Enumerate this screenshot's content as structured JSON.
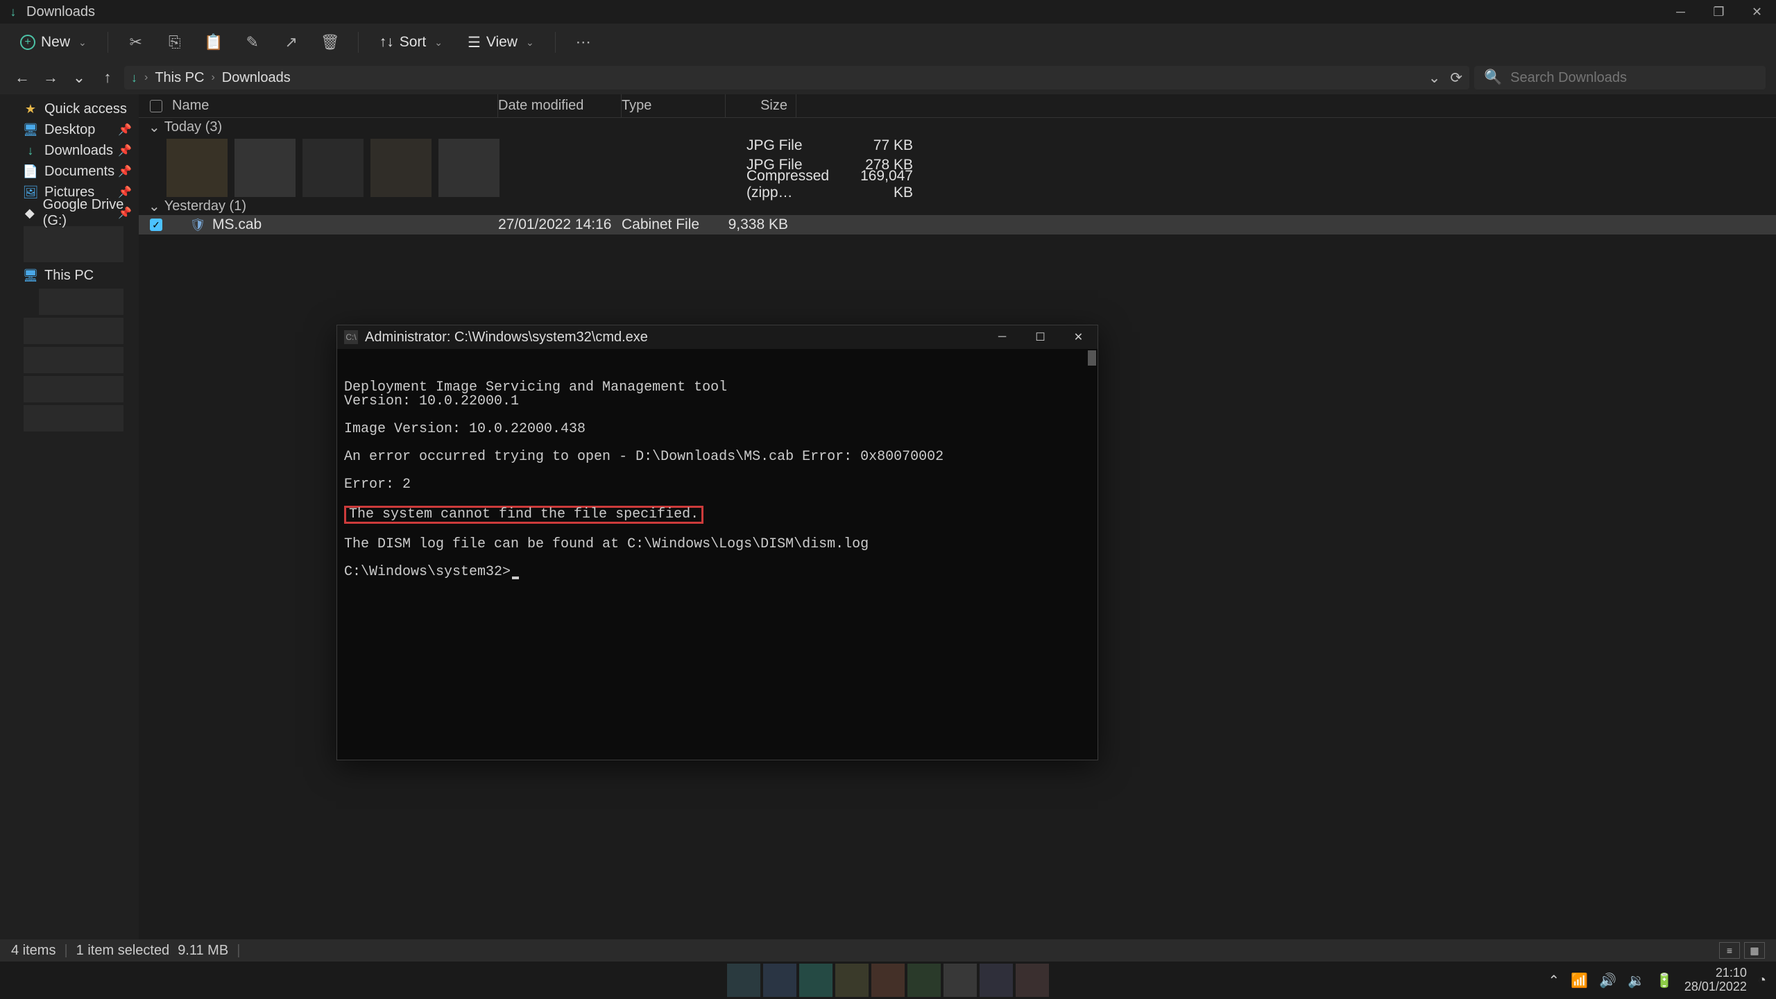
{
  "titlebar": {
    "title": "Downloads"
  },
  "toolbar": {
    "new": "New",
    "sort": "Sort",
    "view": "View"
  },
  "breadcrumb": {
    "root": "This PC",
    "current": "Downloads"
  },
  "search": {
    "placeholder": "Search Downloads"
  },
  "sidebar": {
    "quick_access": "Quick access",
    "desktop": "Desktop",
    "downloads": "Downloads",
    "documents": "Documents",
    "pictures": "Pictures",
    "gdrive": "Google Drive (G:)",
    "this_pc": "This PC"
  },
  "columns": {
    "name": "Name",
    "date": "Date modified",
    "type": "Type",
    "size": "Size"
  },
  "groups": {
    "today": "Today (3)",
    "yesterday": "Yesterday (1)"
  },
  "files": {
    "today": [
      {
        "name": "",
        "date": "",
        "type": "JPG File",
        "size": "77 KB"
      },
      {
        "name": "",
        "date": "",
        "type": "JPG File",
        "size": "278 KB"
      },
      {
        "name": "",
        "date": "",
        "type": "Compressed (zipp…",
        "size": "169,047 KB"
      }
    ],
    "yesterday": [
      {
        "name": "MS.cab",
        "date": "27/01/2022 14:16",
        "type": "Cabinet File",
        "size": "9,338 KB"
      }
    ]
  },
  "status": {
    "items": "4 items",
    "selected": "1 item selected",
    "size": "9.11 MB"
  },
  "cmd": {
    "title": "Administrator: C:\\Windows\\system32\\cmd.exe",
    "l1": "Deployment Image Servicing and Management tool",
    "l2": "Version: 10.0.22000.1",
    "l3": "Image Version: 10.0.22000.438",
    "l4": "An error occurred trying to open - D:\\Downloads\\MS.cab Error: 0x80070002",
    "l5": "Error: 2",
    "l6": "The system cannot find the file specified.",
    "l7": "The DISM log file can be found at C:\\Windows\\Logs\\DISM\\dism.log",
    "l8": "C:\\Windows\\system32>"
  },
  "clock": {
    "time": "21:10",
    "date": "28/01/2022"
  }
}
